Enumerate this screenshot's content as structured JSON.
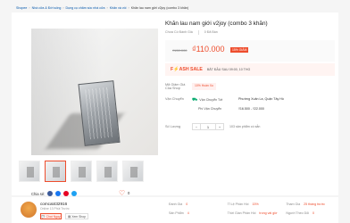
{
  "breadcrumb": [
    "Shopee",
    "Nhà cửa & Đời sống",
    "Dụng cụ chăm sóc nhà cửa",
    "Khăn và vòi",
    "Khăn lau nam giới v2joy (combo 3 khăn)"
  ],
  "product": {
    "title": "Khăn lau nam giới v2joy (combo 3 khăn)",
    "rating_text": "Chưa Có Đánh Giá",
    "sold_text": "0 Đã Bán",
    "old_price": "₫130.000",
    "price": "₫110.000",
    "discount": "15% GIẢM",
    "flash_label": "F⚡ASH SALE",
    "flash_time": "BẮT ĐẦU SAU 09:00, 10 THG",
    "voucher_label": "Mã Giảm Giá Của Shop",
    "voucher_chip": "10% Hoàn Xu",
    "shipping_label": "Vận Chuyển",
    "ship_to_label": "Vận Chuyển Tới",
    "ship_to_value": "Phường Xuân La, Quận Tây Hồ",
    "ship_fee_label": "Phí Vận Chuyển",
    "ship_fee_value": "₫16.500 - ₫22.000",
    "qty_label": "Số Lượng",
    "qty_value": "1",
    "stock_text": "103 sản phẩm có sẵn",
    "share_label": "Chia sẻ:",
    "like_count": "0"
  },
  "shop": {
    "name": "comcat432916",
    "online": "Online 13 Phút Trước",
    "chat_label": "Chat Ngay",
    "view_label": "Xem Shop",
    "stats": [
      {
        "k": "Đánh Giá",
        "v": "0"
      },
      {
        "k": "Tỉ Lệ Phản Hồi",
        "v": "15%"
      },
      {
        "k": "Tham Gia",
        "v": "25 tháng trước"
      },
      {
        "k": "Sản Phẩm",
        "v": "4"
      },
      {
        "k": "Thời Gian Phản Hồi",
        "v": "trong vài giờ"
      },
      {
        "k": "Người Theo Dõi",
        "v": "0"
      }
    ]
  },
  "colors": {
    "accent": "#ee4d2d",
    "link": "#0055aa",
    "ship": "#00a86b"
  }
}
